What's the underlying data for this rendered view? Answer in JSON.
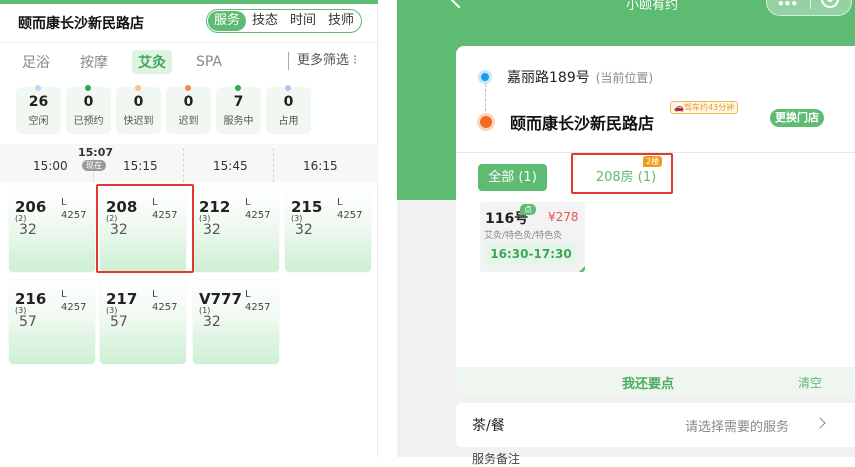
{
  "left": {
    "store_name": "颐而康长沙新民路店",
    "view_tabs": [
      "服务",
      "技态",
      "时间",
      "技师"
    ],
    "categories": [
      "足浴",
      "按摩",
      "艾灸",
      "SPA"
    ],
    "more_filter": "更多筛选",
    "stats": [
      {
        "num": "26",
        "label": "空闲",
        "color": "#bcd8f7"
      },
      {
        "num": "0",
        "label": "已预约",
        "color": "#2fa84f"
      },
      {
        "num": "0",
        "label": "快迟到",
        "color": "#f7c48c"
      },
      {
        "num": "0",
        "label": "迟到",
        "color": "#f48a4e"
      },
      {
        "num": "7",
        "label": "服务中",
        "color": "#2fa84f"
      },
      {
        "num": "0",
        "label": "占用",
        "color": "#c9b8ee"
      }
    ],
    "timeline": {
      "ticks": [
        "15:00",
        "15:15",
        "15:45",
        "16:15"
      ],
      "now_time": "15:07",
      "now_badge": "现在"
    },
    "rooms": [
      {
        "no": "206",
        "cap": "(2)",
        "size": "L",
        "code": "4257",
        "value": "32"
      },
      {
        "no": "208",
        "cap": "(2)",
        "size": "L",
        "code": "4257",
        "value": "32"
      },
      {
        "no": "212",
        "cap": "(3)",
        "size": "L",
        "code": "4257",
        "value": "32"
      },
      {
        "no": "215",
        "cap": "(3)",
        "size": "L",
        "code": "4257",
        "value": "32"
      },
      {
        "no": "216",
        "cap": "(3)",
        "size": "L",
        "code": "4257",
        "value": "57"
      },
      {
        "no": "217",
        "cap": "(3)",
        "size": "L",
        "code": "4257",
        "value": "57"
      },
      {
        "no": "V777",
        "cap": "(1)",
        "size": "L",
        "code": "4257",
        "value": "32"
      }
    ]
  },
  "right": {
    "title": "小颐有约",
    "location": "嘉丽路189号",
    "location_sub": "(当前位置)",
    "store": "颐而康长沙新民路店",
    "drive_tag": "🚗驾车约43分钟",
    "change_store": "更换门店",
    "tab_all": "全部 (1)",
    "tab_room": "208房 (1)",
    "tab_room_badge": "2楼",
    "service": {
      "no": "116号",
      "tag": "点",
      "price": "¥278",
      "desc": "艾灸/特色灸/特色灸",
      "time": "16:30-17:30"
    },
    "order_more": "我还要点",
    "clear": "清空",
    "tea_label": "茶/餐",
    "tea_hint": "请选择需要的服务",
    "cut_text": "服务备注"
  }
}
